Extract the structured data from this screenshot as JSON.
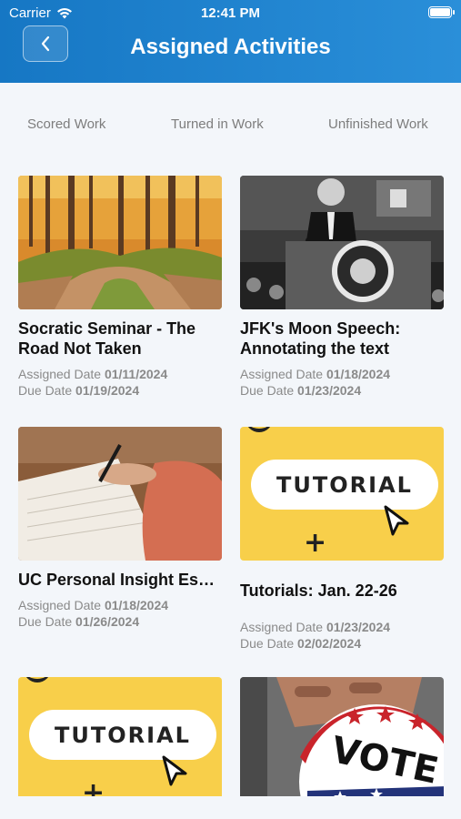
{
  "status": {
    "carrier": "Carrier",
    "time": "12:41 PM"
  },
  "header": {
    "title": "Assigned Activities"
  },
  "tabs": [
    "Scored Work",
    "Turned in Work",
    "Unfinished Work"
  ],
  "labels": {
    "assigned": "Assigned Date",
    "due": "Due Date"
  },
  "cards": [
    {
      "title": "Socratic Seminar - The Road Not Taken",
      "assigned": "01/11/2024",
      "due": "01/19/2024",
      "image": "forest-path"
    },
    {
      "title": "JFK's Moon Speech: Annotating the text",
      "assigned": "01/18/2024",
      "due": "01/23/2024",
      "image": "podium-speech"
    },
    {
      "title": "UC Personal Insight Essay: Describing a ch...",
      "assigned": "01/18/2024",
      "due": "01/26/2024",
      "image": "writing-hand"
    },
    {
      "title": "Tutorials: Jan. 22-26",
      "assigned": "01/23/2024",
      "due": "02/02/2024",
      "image": "tutorial-banner",
      "banner_text": "TUTORIAL"
    },
    {
      "title": "",
      "image": "tutorial-banner",
      "banner_text": "TUTORIAL"
    },
    {
      "title": "",
      "image": "vote-button",
      "banner_text": "VOTE"
    }
  ]
}
